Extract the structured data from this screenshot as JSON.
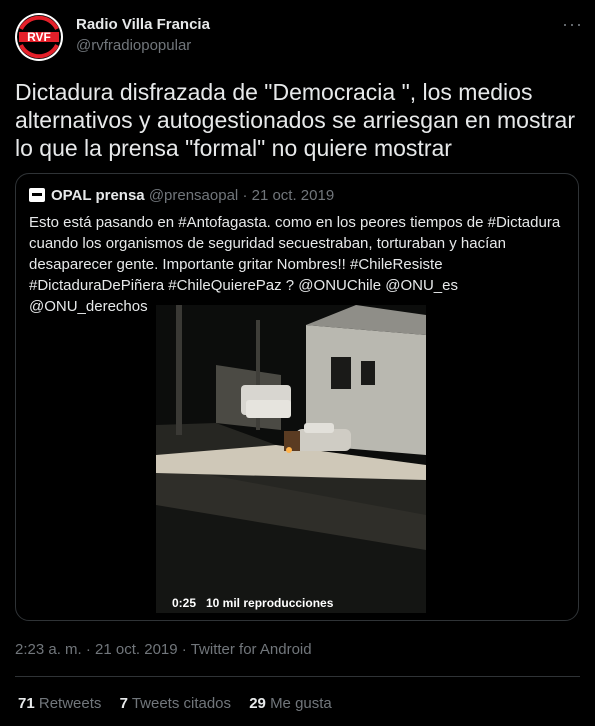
{
  "author": {
    "name": "Radio Villa Francia",
    "handle": "@rvfradiopopular",
    "avatar_text": "RVF"
  },
  "tweet": {
    "text": "Dictadura disfrazada de \"Democracia \", los medios alternativos y autogestionados se arriesgan en mostrar lo que la prensa \"formal\" no quiere mostrar"
  },
  "quoted": {
    "name": "OPAL prensa",
    "handle": "@prensaopal",
    "separator": "·",
    "date": "21 oct. 2019",
    "text": "Esto está pasando en #Antofagasta. como en los peores tiempos de #Dictadura cuando los organismos de seguridad secuestraban, torturaban y hacían desaparecer gente. Importante gritar Nombres!! #ChileResiste #DictaduraDePiñera #ChileQuierePaz ? @ONUChile @ONU_es @ONU_derechos",
    "video": {
      "duration": "0:25",
      "views": "10 mil reproducciones"
    }
  },
  "meta": {
    "time": "2:23 a. m.",
    "separator1": "·",
    "date": "21 oct. 2019",
    "separator2": "·",
    "source": "Twitter for Android"
  },
  "stats": {
    "retweets_count": "71",
    "retweets_label": "Retweets",
    "quotes_count": "7",
    "quotes_label": "Tweets citados",
    "likes_count": "29",
    "likes_label": "Me gusta"
  },
  "colors": {
    "background": "#000000",
    "text": "#e7e9ea",
    "secondary": "#71767b",
    "border": "#2f3336",
    "brand_red": "#e4202a"
  },
  "icons": {
    "more": "more-dots-icon"
  }
}
